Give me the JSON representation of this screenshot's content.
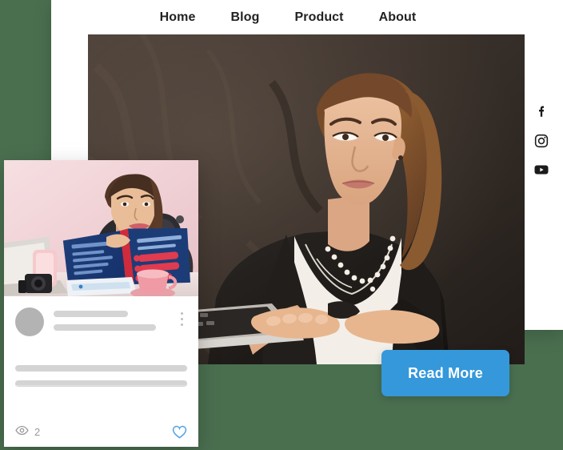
{
  "theme": {
    "background_color": "#4a6f4f",
    "panel_color": "#ffffff",
    "accent_color": "#3498db",
    "placeholder_gray": "#d4d4d4",
    "avatar_gray": "#b3b3b3"
  },
  "nav": {
    "items": [
      {
        "label": "Home",
        "name": "nav-item-home"
      },
      {
        "label": "Blog",
        "name": "nav-item-blog"
      },
      {
        "label": "Product",
        "name": "nav-item-product"
      },
      {
        "label": "About",
        "name": "nav-item-about"
      }
    ]
  },
  "hero": {
    "alt": "Businesswoman in a black blazer with a pearl necklace holding an open silver laptop in front of a dark textured concrete wall",
    "cta": {
      "label": "Read More"
    }
  },
  "social": {
    "items": [
      {
        "icon": "facebook-icon",
        "label": "Facebook"
      },
      {
        "icon": "instagram-icon",
        "label": "Instagram"
      },
      {
        "icon": "youtube-icon",
        "label": "YouTube"
      }
    ]
  },
  "card": {
    "photo_alt": "Woman seated at a desk in front of a pink wall holding an open navy blue book, with a laptop, pink smartphone, camera and pink coffee mug on the desk",
    "menu_icon": "kebab-menu-icon",
    "stats": {
      "views_icon": "eye-icon",
      "views_count": "2",
      "like_icon": "heart-icon"
    }
  }
}
